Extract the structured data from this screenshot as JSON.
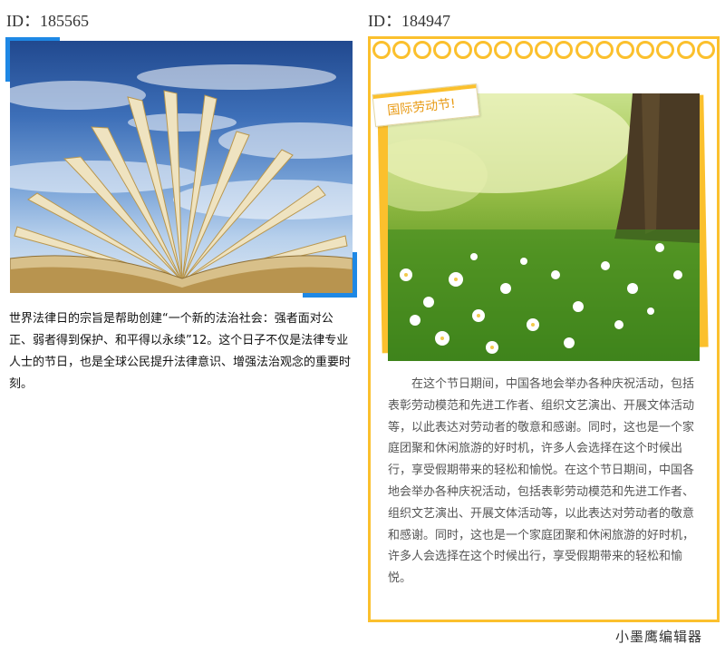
{
  "left": {
    "id_label": "ID：185565",
    "image_alt": "open book against blue sky",
    "paragraph": "世界法律日的宗旨是帮助创建“一个新的法治社会：强者面对公正、弱者得到保护、和平得以永续”12。这个日子不仅是法律专业人士的节日，也是全球公民提升法律意识、增强法治观念的重要时刻。",
    "accent_color": "#1e88e5"
  },
  "right": {
    "id_label": "ID：184947",
    "tag_text": "国际劳动节!",
    "image_alt": "green meadow with white flowers and tree trunk",
    "paragraph": "在这个节日期间，中国各地会举办各种庆祝活动，包括表彰劳动模范和先进工作者、组织文艺演出、开展文体活动等，以此表达对劳动者的敬意和感谢。同时，这也是一个家庭团聚和休闲旅游的好时机，许多人会选择在这个时候出行，享受假期带来的轻松和愉悦。在这个节日期间，中国各地会举办各种庆祝活动，包括表彰劳动模范和先进工作者、组织文艺演出、开展文体活动等，以此表达对劳动者的敬意和感谢。同时，这也是一个家庭团聚和休闲旅游的好时机，许多人会选择在这个时候出行，享受假期带来的轻松和愉悦。",
    "accent_color": "#fbc02d"
  },
  "watermark": "小墨鹰编辑器"
}
